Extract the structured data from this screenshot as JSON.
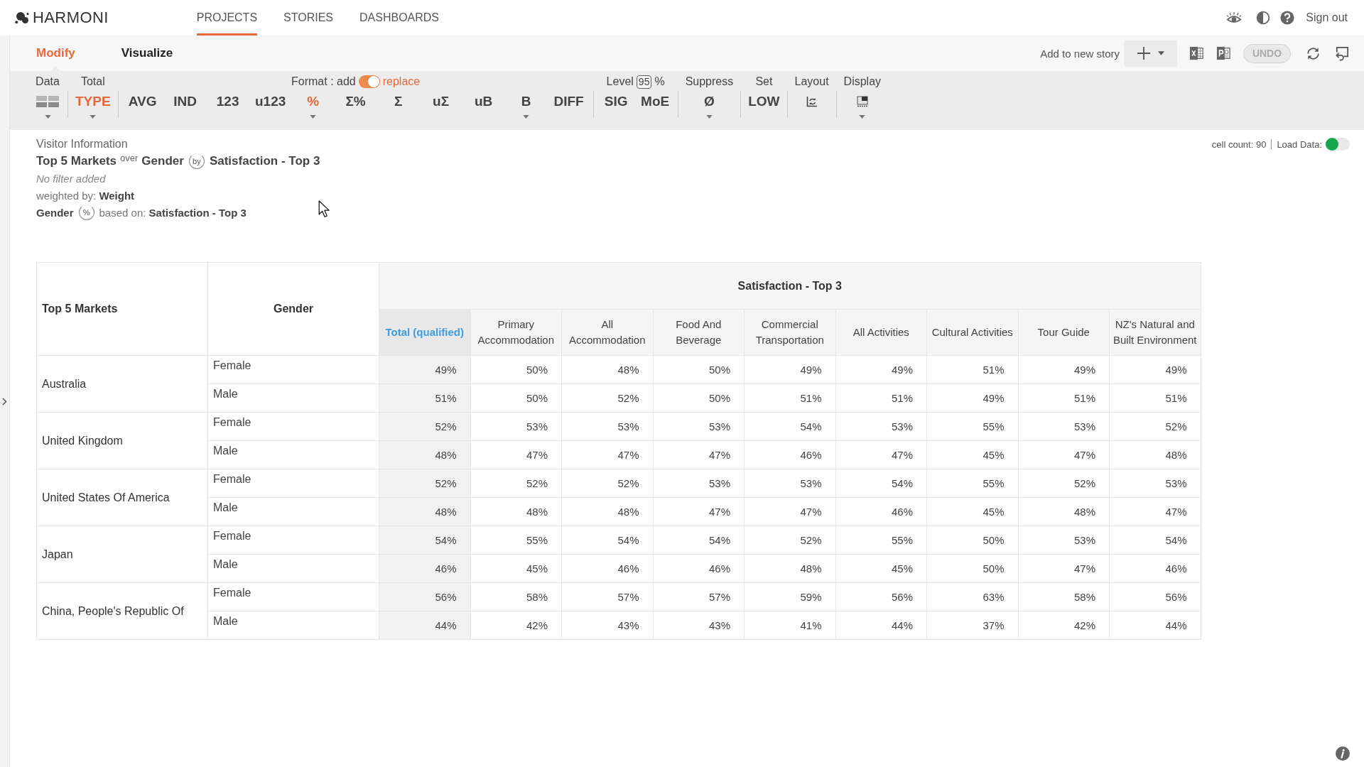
{
  "app": {
    "logo": "HARMONI"
  },
  "nav": {
    "items": [
      {
        "label": "PROJECTS",
        "selected": true
      },
      {
        "label": "STORIES",
        "selected": false
      },
      {
        "label": "DASHBOARDS",
        "selected": false
      }
    ],
    "sign_out": "Sign out"
  },
  "mode_tabs": [
    {
      "label": "Modify",
      "selected": true
    },
    {
      "label": "Visualize",
      "selected": false
    }
  ],
  "story": {
    "label": "Add to new story"
  },
  "undo": {
    "label": "UNDO",
    "disabled": true
  },
  "toolbar": {
    "groups": [
      {
        "header": {
          "kind": "label",
          "text": "Data"
        },
        "buttons": [
          {
            "kind": "grid",
            "selected": false,
            "menu": true
          }
        ]
      },
      {
        "header": {
          "kind": "label",
          "text": "Total"
        },
        "buttons": [
          {
            "kind": "text",
            "label": "TYPE",
            "selected": true,
            "menu": true
          }
        ]
      },
      {
        "header": {
          "kind": "format",
          "text": "Format : add",
          "on_text": "replace",
          "on": true
        },
        "buttons": [
          {
            "kind": "text",
            "label": "AVG",
            "selected": false,
            "menu": false
          },
          {
            "kind": "text",
            "label": "IND",
            "selected": false,
            "menu": false
          },
          {
            "kind": "text",
            "label": "123",
            "selected": false,
            "menu": false
          },
          {
            "kind": "text",
            "label": "u123",
            "selected": false,
            "menu": false
          },
          {
            "kind": "text",
            "label": "%",
            "selected": true,
            "menu": true
          },
          {
            "kind": "text",
            "label": "Σ%",
            "selected": false,
            "menu": false
          },
          {
            "kind": "text",
            "label": "Σ",
            "selected": false,
            "menu": false
          },
          {
            "kind": "text",
            "label": "uΣ",
            "selected": false,
            "menu": false
          },
          {
            "kind": "text",
            "label": "uB",
            "selected": false,
            "menu": false
          },
          {
            "kind": "text",
            "label": "B",
            "selected": false,
            "menu": true
          },
          {
            "kind": "text",
            "label": "DIFF",
            "selected": false,
            "menu": false
          }
        ]
      },
      {
        "header": {
          "kind": "level",
          "text": "Level",
          "value": "95",
          "unit": "%"
        },
        "buttons": [
          {
            "kind": "text",
            "label": "SIG",
            "selected": false,
            "menu": false
          },
          {
            "kind": "text",
            "label": "MoE",
            "selected": false,
            "menu": false
          }
        ]
      },
      {
        "header": {
          "kind": "label",
          "text": "Suppress"
        },
        "buttons": [
          {
            "kind": "text",
            "label": "Ø",
            "selected": false,
            "menu": true
          }
        ]
      },
      {
        "header": {
          "kind": "label",
          "text": "Set"
        },
        "buttons": [
          {
            "kind": "text",
            "label": "LOW",
            "selected": false,
            "menu": false
          }
        ]
      },
      {
        "header": {
          "kind": "label",
          "text": "Layout"
        },
        "buttons": [
          {
            "kind": "layout",
            "selected": false,
            "menu": false
          }
        ]
      },
      {
        "header": {
          "kind": "label",
          "text": "Display"
        },
        "buttons": [
          {
            "kind": "display",
            "selected": false,
            "menu": true
          }
        ]
      }
    ]
  },
  "summary": {
    "dataset": "Visitor Information",
    "rows_variable": "Top 5 Markets",
    "connector": "over",
    "columns_variable": "Gender",
    "swap": "by",
    "banner_variable": "Satisfaction - Top 3",
    "filter": "No filter added",
    "weighting": "weighted by: **Weight**",
    "base_variable": "Gender",
    "base_mode": "%",
    "based_on": "based on: **Satisfaction - Top 3**"
  },
  "status": {
    "cell_count": "cell count: 90",
    "load_data": {
      "label": "Load Data:",
      "on": false
    }
  },
  "table": {
    "row_headers": [
      "Top 5 Markets",
      "Gender"
    ],
    "banner": "Satisfaction - Top 3",
    "columns": [
      {
        "label": "Total (qualified)",
        "kind": "total"
      },
      {
        "label": "Primary Accommodation",
        "kind": "category"
      },
      {
        "label": "All Accommodation",
        "kind": "category"
      },
      {
        "label": "Food And Beverage",
        "kind": "category"
      },
      {
        "label": "Commercial Transportation",
        "kind": "category"
      },
      {
        "label": "All Activities",
        "kind": "category"
      },
      {
        "label": "Cultural Activities",
        "kind": "category"
      },
      {
        "label": "Tour Guide",
        "kind": "category"
      },
      {
        "label": "NZ's Natural and Built Environment",
        "kind": "category"
      }
    ],
    "rows": [
      {
        "market": "Australia",
        "groups": [
          {
            "gender": "Female",
            "values": [
              "49%",
              "50%",
              "48%",
              "50%",
              "49%",
              "49%",
              "51%",
              "49%",
              "49%"
            ]
          },
          {
            "gender": "Male",
            "values": [
              "51%",
              "50%",
              "52%",
              "50%",
              "51%",
              "51%",
              "49%",
              "51%",
              "51%"
            ]
          }
        ]
      },
      {
        "market": "United Kingdom",
        "groups": [
          {
            "gender": "Female",
            "values": [
              "52%",
              "53%",
              "53%",
              "53%",
              "54%",
              "53%",
              "55%",
              "53%",
              "52%"
            ]
          },
          {
            "gender": "Male",
            "values": [
              "48%",
              "47%",
              "47%",
              "47%",
              "46%",
              "47%",
              "45%",
              "47%",
              "48%"
            ]
          }
        ]
      },
      {
        "market": "United States Of America",
        "groups": [
          {
            "gender": "Female",
            "values": [
              "52%",
              "52%",
              "52%",
              "53%",
              "53%",
              "54%",
              "55%",
              "52%",
              "53%"
            ]
          },
          {
            "gender": "Male",
            "values": [
              "48%",
              "48%",
              "48%",
              "47%",
              "47%",
              "46%",
              "45%",
              "48%",
              "47%"
            ]
          }
        ]
      },
      {
        "market": "Japan",
        "groups": [
          {
            "gender": "Female",
            "values": [
              "54%",
              "55%",
              "54%",
              "54%",
              "52%",
              "55%",
              "50%",
              "53%",
              "54%"
            ]
          },
          {
            "gender": "Male",
            "values": [
              "46%",
              "45%",
              "46%",
              "46%",
              "48%",
              "45%",
              "50%",
              "47%",
              "46%"
            ]
          }
        ]
      },
      {
        "market": "China, People's Republic Of",
        "groups": [
          {
            "gender": "Female",
            "values": [
              "56%",
              "58%",
              "57%",
              "57%",
              "59%",
              "56%",
              "63%",
              "58%",
              "56%"
            ]
          },
          {
            "gender": "Male",
            "values": [
              "44%",
              "42%",
              "43%",
              "43%",
              "41%",
              "44%",
              "37%",
              "42%",
              "44%"
            ]
          }
        ]
      }
    ]
  }
}
